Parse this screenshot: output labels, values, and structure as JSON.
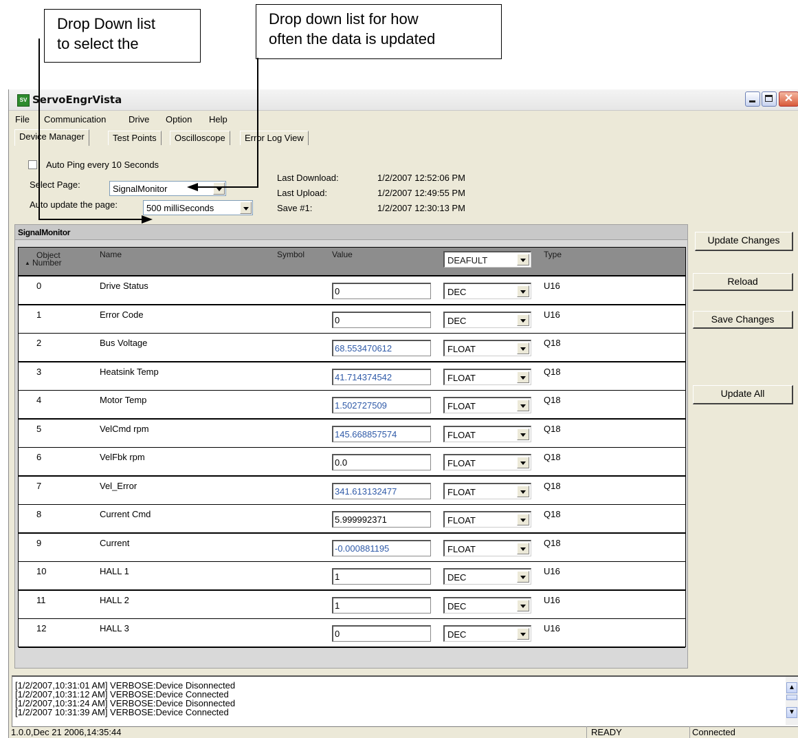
{
  "annotations": {
    "select_page_note": "Drop Down list\nto select the",
    "update_rate_note": "Drop down list for how\noften the data is updated"
  },
  "window": {
    "title": "ServoEngrVista",
    "icon_text": "SV"
  },
  "menu": [
    "File",
    "Communication",
    "Drive",
    "Option",
    "Help"
  ],
  "tabs": [
    "Device Manager",
    "Test Points",
    "Oscilloscope",
    "Error Log View"
  ],
  "settings": {
    "auto_ping_label": "Auto Ping every 10 Seconds",
    "select_page_label": "Select Page:",
    "select_page_value": "SignalMonitor",
    "auto_update_label": "Auto update the page:",
    "auto_update_value": "500 milliSeconds"
  },
  "info": {
    "last_download_label": "Last Download:",
    "last_download_value": "1/2/2007 12:52:06 PM",
    "last_upload_label": "Last Upload:",
    "last_upload_value": "1/2/2007 12:49:55 PM",
    "save_label": "Save #1:",
    "save_value": "1/2/2007 12:30:13 PM"
  },
  "grid": {
    "title": "SignalMonitor",
    "headers": {
      "object_number_1": "Object",
      "object_number_2": "Number",
      "name": "Name",
      "symbol": "Symbol",
      "value": "Value",
      "format": "DEAFULT",
      "type": "Type"
    },
    "rows": [
      {
        "num": "0",
        "name": "Drive Status",
        "value": "0",
        "format": "DEC",
        "type": "U16",
        "blue": false
      },
      {
        "num": "1",
        "name": "Error Code",
        "value": "0",
        "format": "DEC",
        "type": "U16",
        "blue": false
      },
      {
        "num": "2",
        "name": "Bus Voltage",
        "value": "68.553470612",
        "format": "FLOAT",
        "type": "Q18",
        "blue": true
      },
      {
        "num": "3",
        "name": "Heatsink Temp",
        "value": "41.714374542",
        "format": "FLOAT",
        "type": "Q18",
        "blue": true
      },
      {
        "num": "4",
        "name": "Motor Temp",
        "value": "1.502727509",
        "format": "FLOAT",
        "type": "Q18",
        "blue": true
      },
      {
        "num": "5",
        "name": "VelCmd rpm",
        "value": "145.668857574",
        "format": "FLOAT",
        "type": "Q18",
        "blue": true
      },
      {
        "num": "6",
        "name": "VelFbk rpm",
        "value": "0.0",
        "format": "FLOAT",
        "type": "Q18",
        "blue": false
      },
      {
        "num": "7",
        "name": "Vel_Error",
        "value": "341.613132477",
        "format": "FLOAT",
        "type": "Q18",
        "blue": true
      },
      {
        "num": "8",
        "name": "Current Cmd",
        "value": "5.999992371",
        "format": "FLOAT",
        "type": "Q18",
        "blue": false
      },
      {
        "num": "9",
        "name": "Current",
        "value": "-0.000881195",
        "format": "FLOAT",
        "type": "Q18",
        "blue": true
      },
      {
        "num": "10",
        "name": "HALL 1",
        "value": "1",
        "format": "DEC",
        "type": "U16",
        "blue": false
      },
      {
        "num": "11",
        "name": "HALL 2",
        "value": "1",
        "format": "DEC",
        "type": "U16",
        "blue": false
      },
      {
        "num": "12",
        "name": "HALL 3",
        "value": "0",
        "format": "DEC",
        "type": "U16",
        "blue": false
      }
    ]
  },
  "buttons": {
    "update_changes": "Update Changes",
    "reload": "Reload",
    "save_changes": "Save Changes",
    "update_all": "Update All"
  },
  "log": [
    "[1/2/2007,10:31:01 AM] VERBOSE:Device Disonnected",
    "[1/2/2007,10:31:12 AM] VERBOSE:Device Connected",
    "[1/2/2007,10:31:24 AM] VERBOSE:Device Disonnected",
    "[1/2/2007 10:31:39 AM] VERBOSE:Device Connected"
  ],
  "status": {
    "version": "1.0.0,Dec 21 2006,14:35:44",
    "state": "READY",
    "connection": "Connected"
  },
  "colors": {
    "blue_value": "#2f5aa8",
    "header_gray": "#8d8d8d",
    "window_bg": "#ece9d8"
  }
}
